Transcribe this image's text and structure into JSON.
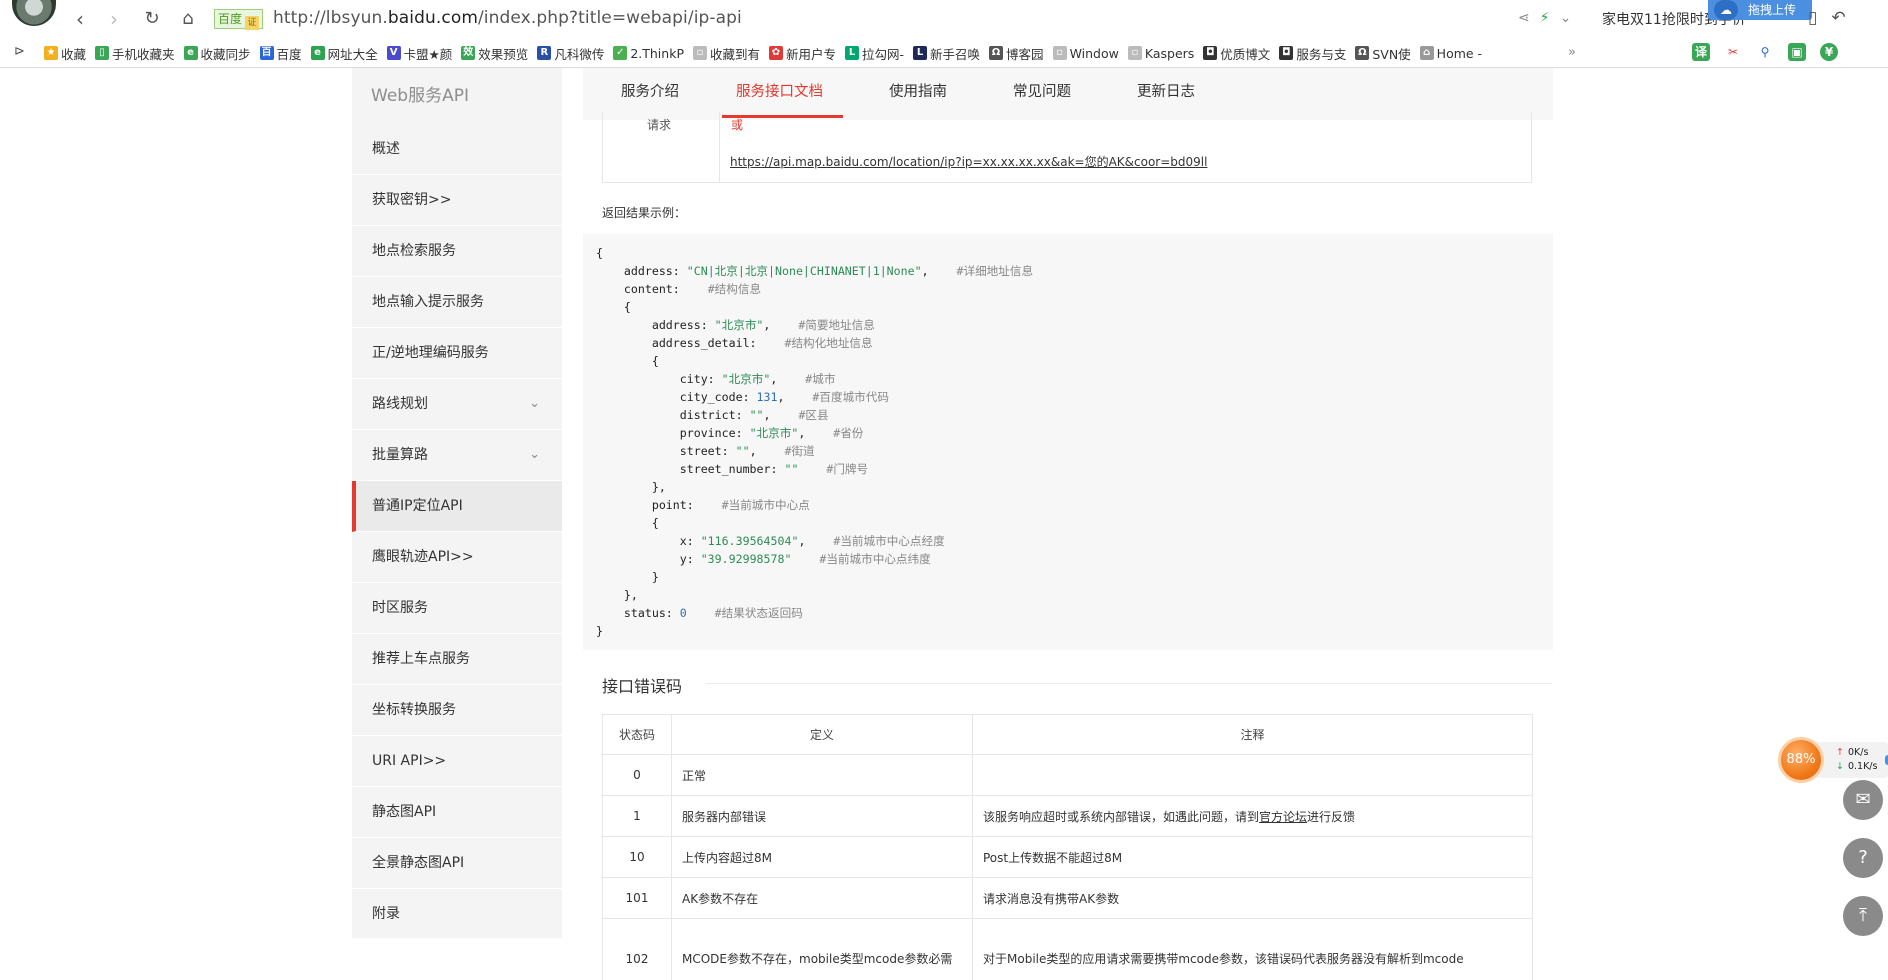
{
  "browser": {
    "url_badge": "百度",
    "url_badge_icon": "证",
    "url_prefix": "http://lbsyun.",
    "url_domain": "baidu.com",
    "url_path": "/index.php?title=webapi/ip-api",
    "promo_text": "家电双11抢限时到手价",
    "upload_label": "拖拽上传",
    "bookmarks": [
      {
        "label": "收藏",
        "icon": "star-icon",
        "color": "#f2b01e",
        "glyph": "★"
      },
      {
        "label": "手机收藏夹",
        "icon": "phone-icon",
        "color": "#3aa757",
        "glyph": "▯"
      },
      {
        "label": "收藏同步",
        "icon": "sync-icon",
        "color": "#3aa757",
        "glyph": "e"
      },
      {
        "label": "百度",
        "icon": "baidu-icon",
        "color": "#2b66d9",
        "glyph": "百"
      },
      {
        "label": "网址大全",
        "icon": "globe-icon",
        "color": "#2aa44f",
        "glyph": "e"
      },
      {
        "label": "卡盟★颜",
        "icon": "v-icon",
        "color": "#4a4ad0",
        "glyph": "V"
      },
      {
        "label": "效果预览",
        "icon": "grid-icon",
        "color": "#3aa757",
        "glyph": "效"
      },
      {
        "label": "凡科微传",
        "icon": "r-icon",
        "color": "#2b4fa8",
        "glyph": "R"
      },
      {
        "label": "2.ThinkP",
        "icon": "leaf-icon",
        "color": "#4caf50",
        "glyph": "✓"
      },
      {
        "label": "收藏到有",
        "icon": "page-icon",
        "color": "#bbbbbb",
        "glyph": "▫"
      },
      {
        "label": "新用户专",
        "icon": "huawei-icon",
        "color": "#e03a3a",
        "glyph": "✿"
      },
      {
        "label": "拉勾网-",
        "icon": "lagou-icon",
        "color": "#00a870",
        "glyph": "L"
      },
      {
        "label": "新手召唤",
        "icon": "l-icon",
        "color": "#1e2a5a",
        "glyph": "L"
      },
      {
        "label": "博客园",
        "icon": "cnblogs-icon",
        "color": "#555555",
        "glyph": "Ω"
      },
      {
        "label": "Window",
        "icon": "page-icon",
        "color": "#bbbbbb",
        "glyph": "▫"
      },
      {
        "label": "Kaspers",
        "icon": "page-icon",
        "color": "#bbbbbb",
        "glyph": "▫"
      },
      {
        "label": "优质博文",
        "icon": "link-icon",
        "color": "#333333",
        "glyph": "◘"
      },
      {
        "label": "服务与支",
        "icon": "link-icon",
        "color": "#333333",
        "glyph": "◘"
      },
      {
        "label": "SVN使",
        "icon": "svn-icon",
        "color": "#555555",
        "glyph": "Ω"
      },
      {
        "label": "Home -",
        "icon": "home-icon",
        "color": "#999999",
        "glyph": "⌂"
      }
    ]
  },
  "sidebar": {
    "title": "Web服务API",
    "items": [
      {
        "label": "概述",
        "chevron": false,
        "active": false
      },
      {
        "label": "获取密钥>>",
        "chevron": false,
        "active": false
      },
      {
        "label": "地点检索服务",
        "chevron": false,
        "active": false
      },
      {
        "label": "地点输入提示服务",
        "chevron": false,
        "active": false
      },
      {
        "label": "正/逆地理编码服务",
        "chevron": false,
        "active": false
      },
      {
        "label": "路线规划",
        "chevron": true,
        "active": false
      },
      {
        "label": "批量算路",
        "chevron": true,
        "active": false
      },
      {
        "label": "普通IP定位API",
        "chevron": false,
        "active": true
      },
      {
        "label": "鹰眼轨迹API>>",
        "chevron": false,
        "active": false
      },
      {
        "label": "时区服务",
        "chevron": false,
        "active": false
      },
      {
        "label": "推荐上车点服务",
        "chevron": false,
        "active": false
      },
      {
        "label": "坐标转换服务",
        "chevron": false,
        "active": false
      },
      {
        "label": "URI API>>",
        "chevron": false,
        "active": false
      },
      {
        "label": "静态图API",
        "chevron": false,
        "active": false
      },
      {
        "label": "全景静态图API",
        "chevron": false,
        "active": false
      },
      {
        "label": "附录",
        "chevron": false,
        "active": false
      }
    ]
  },
  "tabs": [
    {
      "label": "服务介绍",
      "active": false
    },
    {
      "label": "服务接口文档",
      "active": true
    },
    {
      "label": "使用指南",
      "active": false
    },
    {
      "label": "常见问题",
      "active": false
    },
    {
      "label": "更新日志",
      "active": false
    }
  ],
  "request": {
    "label": "请求",
    "or_text": "或",
    "link": "https://api.map.baidu.com/location/ip?ip=xx.xx.xx.xx&ak=您的AK&coor=bd09ll"
  },
  "example_label": "返回结果示例：",
  "code_lines": [
    [
      {
        "t": "{",
        "c": ""
      }
    ],
    [
      {
        "t": "    address: ",
        "c": ""
      },
      {
        "t": "\"CN|北京|北京|None|CHINANET|1|None\"",
        "c": "str"
      },
      {
        "t": ",    ",
        "c": ""
      },
      {
        "t": "#详细地址信息",
        "c": "cm"
      }
    ],
    [
      {
        "t": "    content:    ",
        "c": ""
      },
      {
        "t": "#结构信息",
        "c": "cm"
      }
    ],
    [
      {
        "t": "    {",
        "c": ""
      }
    ],
    [
      {
        "t": "        address: ",
        "c": ""
      },
      {
        "t": "\"北京市\"",
        "c": "str"
      },
      {
        "t": ",    ",
        "c": ""
      },
      {
        "t": "#简要地址信息",
        "c": "cm"
      }
    ],
    [
      {
        "t": "        address_detail:    ",
        "c": ""
      },
      {
        "t": "#结构化地址信息",
        "c": "cm"
      }
    ],
    [
      {
        "t": "        {",
        "c": ""
      }
    ],
    [
      {
        "t": "            city: ",
        "c": ""
      },
      {
        "t": "\"北京市\"",
        "c": "str"
      },
      {
        "t": ",    ",
        "c": ""
      },
      {
        "t": "#城市",
        "c": "cm"
      }
    ],
    [
      {
        "t": "            city_code: ",
        "c": ""
      },
      {
        "t": "131",
        "c": "num"
      },
      {
        "t": ",    ",
        "c": ""
      },
      {
        "t": "#百度城市代码",
        "c": "cm"
      }
    ],
    [
      {
        "t": "            district: ",
        "c": ""
      },
      {
        "t": "\"\"",
        "c": "str"
      },
      {
        "t": ",    ",
        "c": ""
      },
      {
        "t": "#区县",
        "c": "cm"
      }
    ],
    [
      {
        "t": "            province: ",
        "c": ""
      },
      {
        "t": "\"北京市\"",
        "c": "str"
      },
      {
        "t": ",    ",
        "c": ""
      },
      {
        "t": "#省份",
        "c": "cm"
      }
    ],
    [
      {
        "t": "            street: ",
        "c": ""
      },
      {
        "t": "\"\"",
        "c": "str"
      },
      {
        "t": ",    ",
        "c": ""
      },
      {
        "t": "#街道",
        "c": "cm"
      }
    ],
    [
      {
        "t": "            street_number: ",
        "c": ""
      },
      {
        "t": "\"\"",
        "c": "str"
      },
      {
        "t": "    ",
        "c": ""
      },
      {
        "t": "#门牌号",
        "c": "cm"
      }
    ],
    [
      {
        "t": "        },",
        "c": ""
      }
    ],
    [
      {
        "t": "        point:    ",
        "c": ""
      },
      {
        "t": "#当前城市中心点",
        "c": "cm"
      }
    ],
    [
      {
        "t": "        {",
        "c": ""
      }
    ],
    [
      {
        "t": "            x: ",
        "c": ""
      },
      {
        "t": "\"116.39564504\"",
        "c": "str"
      },
      {
        "t": ",    ",
        "c": ""
      },
      {
        "t": "#当前城市中心点经度",
        "c": "cm"
      }
    ],
    [
      {
        "t": "            y: ",
        "c": ""
      },
      {
        "t": "\"39.92998578\"",
        "c": "str"
      },
      {
        "t": "    ",
        "c": ""
      },
      {
        "t": "#当前城市中心点纬度",
        "c": "cm"
      }
    ],
    [
      {
        "t": "        }",
        "c": ""
      }
    ],
    [
      {
        "t": "    },",
        "c": ""
      }
    ],
    [
      {
        "t": "    status: ",
        "c": ""
      },
      {
        "t": "0",
        "c": "num"
      },
      {
        "t": "    ",
        "c": ""
      },
      {
        "t": "#结果状态返回码",
        "c": "cm"
      }
    ],
    [
      {
        "t": "}",
        "c": ""
      }
    ]
  ],
  "error_section": {
    "title": "接口错误码",
    "headers": [
      "状态码",
      "定义",
      "注释"
    ],
    "rows": [
      {
        "code": "0",
        "definition": "正常",
        "note": "",
        "link": ""
      },
      {
        "code": "1",
        "definition": "服务器内部错误",
        "note": "该服务响应超时或系统内部错误，如遇此问题，请到",
        "link": "官方论坛",
        "note_after": "进行反馈"
      },
      {
        "code": "10",
        "definition": "上传内容超过8M",
        "note": "Post上传数据不能超过8M",
        "link": ""
      },
      {
        "code": "101",
        "definition": "AK参数不存在",
        "note": "请求消息没有携带AK参数",
        "link": ""
      },
      {
        "code": "102",
        "definition": "MCODE参数不存在，mobile类型mcode参数必需",
        "note": "对于Mobile类型的应用请求需要携带mcode参数，该错误码代表服务器没有解析到mcode",
        "link": ""
      }
    ]
  },
  "widgets": {
    "net_percent": "88%",
    "up_speed": "0K/s",
    "down_speed": "0.1K/s"
  }
}
